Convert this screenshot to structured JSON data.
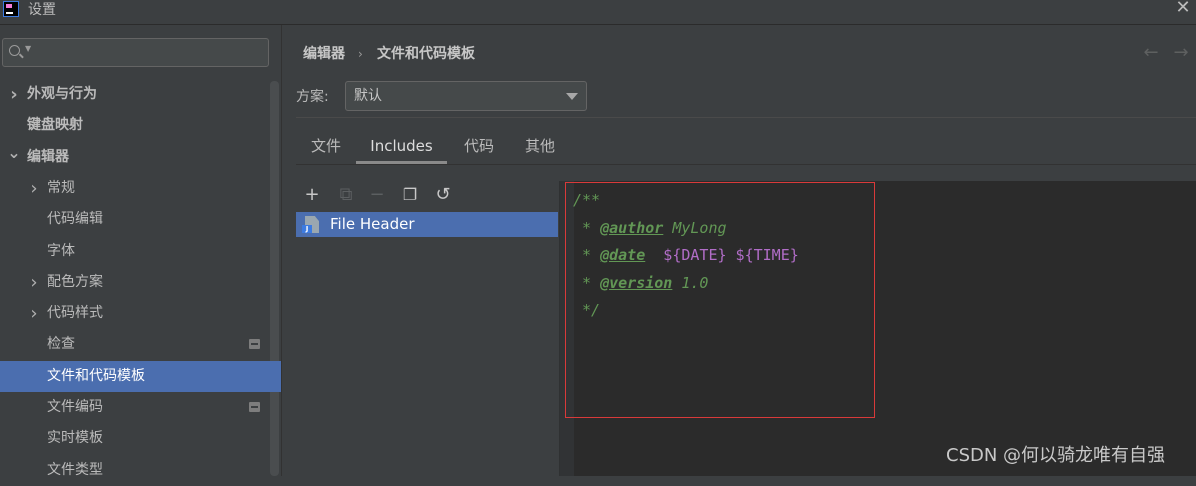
{
  "window": {
    "title": "设置",
    "close_glyph": "✕"
  },
  "sidebar": {
    "search": {
      "value": "",
      "placeholder": ""
    },
    "items": [
      {
        "label": "外观与行为",
        "expand": "collapsed",
        "bold": true
      },
      {
        "label": "键盘映射",
        "expand": "none",
        "bold": true
      },
      {
        "label": "编辑器",
        "expand": "expanded",
        "bold": true
      },
      {
        "label": "常规",
        "expand": "collapsed"
      },
      {
        "label": "代码编辑",
        "expand": "none"
      },
      {
        "label": "字体",
        "expand": "none"
      },
      {
        "label": "配色方案",
        "expand": "collapsed"
      },
      {
        "label": "代码样式",
        "expand": "collapsed"
      },
      {
        "label": "检查",
        "expand": "none",
        "badge_icon": "project-settings-icon"
      },
      {
        "label": "文件和代码模板",
        "expand": "none",
        "selected": true
      },
      {
        "label": "文件编码",
        "expand": "none",
        "badge_icon": "project-settings-icon"
      },
      {
        "label": "实时模板",
        "expand": "none"
      },
      {
        "label": "文件类型",
        "expand": "none"
      }
    ]
  },
  "breadcrumb": {
    "parent": "编辑器",
    "separator": "›",
    "current": "文件和代码模板"
  },
  "nav": {
    "back_glyph": "←",
    "forward_glyph": "→"
  },
  "scheme": {
    "label": "方案:",
    "value": "默认"
  },
  "tabs": [
    {
      "label": "文件"
    },
    {
      "label": "Includes",
      "active": true
    },
    {
      "label": "代码"
    },
    {
      "label": "其他"
    }
  ],
  "toolbar": {
    "add_glyph": "+",
    "copy_disabled_glyph": "⧉",
    "remove_glyph": "−",
    "duplicate_glyph": "❐",
    "reset_glyph": "↺"
  },
  "template_list": [
    {
      "label": "File Header",
      "icon_badge": "J",
      "selected": true
    }
  ],
  "editor": {
    "lines": [
      {
        "text": "/**"
      },
      {
        "prefix": " * ",
        "tag": "@author",
        "rest": " MyLong"
      },
      {
        "prefix": " * ",
        "tag": "@date",
        "rest_var": "  ${DATE} ${TIME}"
      },
      {
        "prefix": " * ",
        "tag": "@version",
        "rest": " 1.0"
      },
      {
        "text": " */"
      }
    ]
  },
  "colors": {
    "selection": "#4b6eaf",
    "comment": "#629755",
    "variable": "#b16dc7",
    "highlight_box": "#d93a3a"
  },
  "watermark": "CSDN @何以骑龙唯有自强"
}
